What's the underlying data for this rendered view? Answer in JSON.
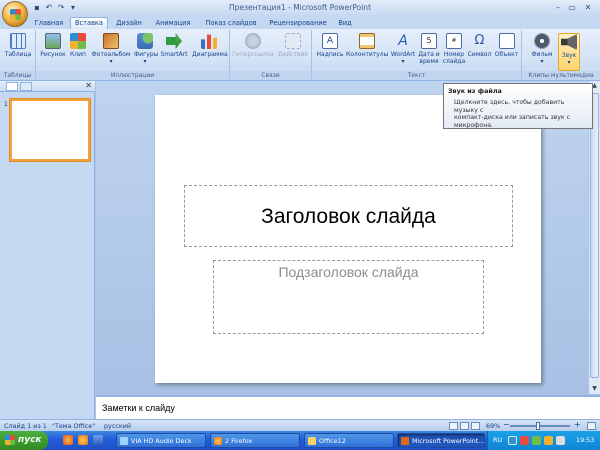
{
  "window": {
    "title": "Презентация1 - Microsoft PowerPoint",
    "minimize": "–",
    "maximize": "▭",
    "close": "✕"
  },
  "qat": {
    "save": "▪",
    "undo": "↶",
    "redo": "↷",
    "more": "▾"
  },
  "tabs": [
    {
      "label": "Главная"
    },
    {
      "label": "Вставка"
    },
    {
      "label": "Дизайн"
    },
    {
      "label": "Анимация"
    },
    {
      "label": "Показ слайдов"
    },
    {
      "label": "Рецензирование"
    },
    {
      "label": "Вид"
    }
  ],
  "ribbon": {
    "groups": {
      "tables": "Таблицы",
      "illustrations": "Иллюстрации",
      "links": "Связи",
      "text": "Текст",
      "media": "Клипы мультимедиа"
    },
    "buttons": {
      "table": "Таблица",
      "picture": "Рисунок",
      "clip": "Клип",
      "photo_album": "Фотоальбом",
      "shapes": "Фигуры",
      "smartart": "SmartArt",
      "chart": "Диаграмма",
      "hyperlink": "Гиперссылка",
      "action": "Действие",
      "textbox": "Надпись",
      "header_footer": "Колонтитулы",
      "wordart": "WordArt",
      "date_time_1": "Дата и",
      "date_time_2": "время",
      "slide_number_1": "Номер",
      "slide_number_2": "слайда",
      "symbol": "Символ",
      "object": "Объект",
      "movie": "Фильм",
      "sound": "Звук"
    }
  },
  "tooltip": {
    "title": "Звук из файла",
    "body_1": "Щелкните здесь, чтобы добавить музыку с",
    "body_2": "компакт-диска или записать звук с",
    "body_3": "микрофона."
  },
  "left_pane": {
    "slide_number": "1",
    "close": "✕"
  },
  "slide": {
    "title_placeholder": "Заголовок слайда",
    "subtitle_placeholder": "Подзаголовок слайда"
  },
  "notes": {
    "placeholder": "Заметки к слайду"
  },
  "status": {
    "slide_info": "Слайд 1 из 1",
    "theme": "\"Тема Office\"",
    "language": "русский",
    "zoom": "69%",
    "zoom_out": "−",
    "zoom_in": "+"
  },
  "taskbar": {
    "start": "пуск",
    "tasks": [
      {
        "label": "VIA HD Audio Deck"
      },
      {
        "label": "2 Firefox"
      },
      {
        "label": "Office12"
      },
      {
        "label": "Microsoft PowerPoint..."
      }
    ],
    "lang": "RU",
    "time": "19:53"
  },
  "colors": {
    "ribbon_bg": "#d3e2f6",
    "accent_orange": "#f3a23c",
    "taskbar": "#245edb",
    "start_green": "#2f8a22"
  }
}
